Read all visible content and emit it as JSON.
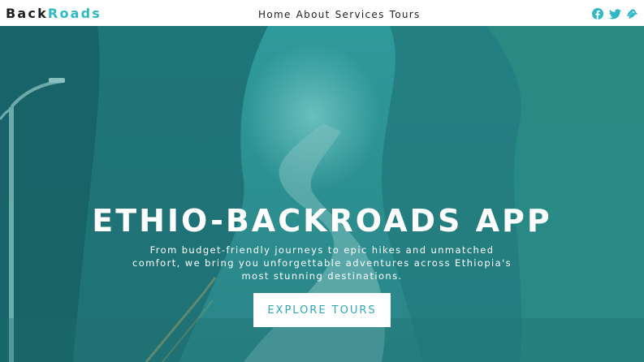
{
  "brand": {
    "part1": "Back",
    "part2": "Roads"
  },
  "nav": {
    "links": [
      {
        "label": "Home"
      },
      {
        "label": "About"
      },
      {
        "label": "Services"
      },
      {
        "label": "Tours"
      }
    ]
  },
  "social": {
    "icons": [
      "facebook-icon",
      "twitter-icon",
      "squarespace-icon"
    ]
  },
  "hero": {
    "title": "ETHIO-BACKROADS APP",
    "subtitle_lines": [
      "From budget-friendly journeys to epic hikes and unmatched",
      "comfort, we bring you unforgettable adventures across Ethiopia's",
      "most stunning destinations."
    ],
    "cta_label": "EXPLORE TOURS"
  },
  "colors": {
    "accent": "#2fb8c6",
    "overlay": "#2b8e90",
    "text_dark": "#1f1f1f"
  }
}
